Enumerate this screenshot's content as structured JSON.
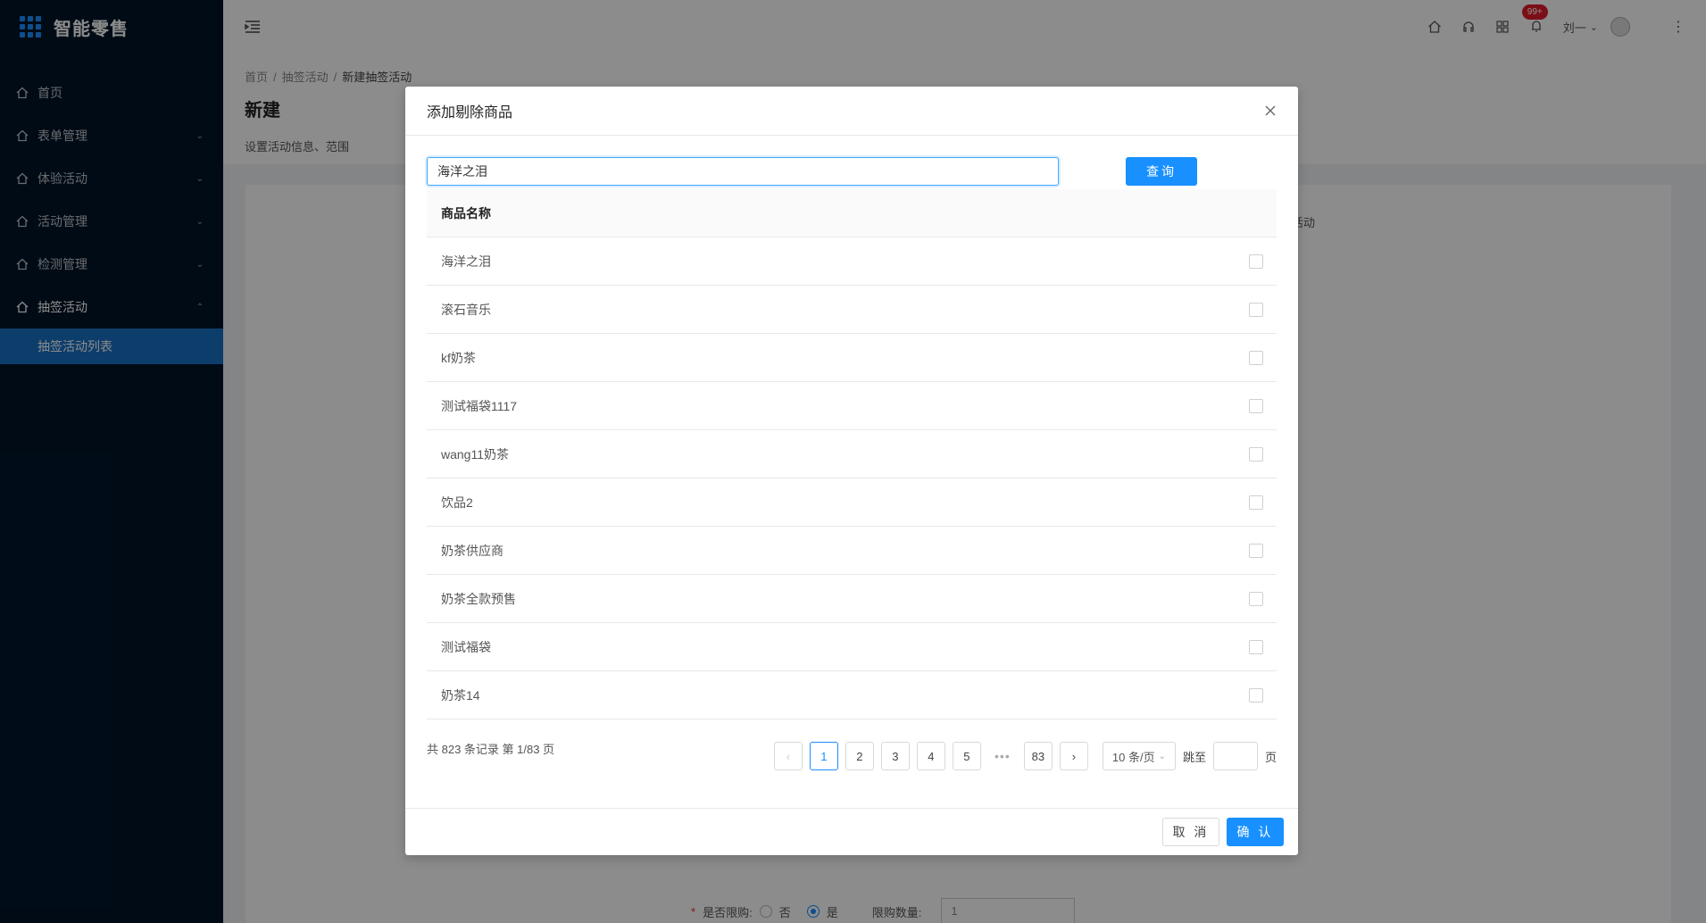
{
  "app": {
    "title": "智能零售"
  },
  "sidebar": {
    "items": [
      {
        "label": "首页",
        "icon": "home-icon"
      },
      {
        "label": "表单管理",
        "icon": "home-icon"
      },
      {
        "label": "体验活动",
        "icon": "home-icon"
      },
      {
        "label": "活动管理",
        "icon": "home-icon"
      },
      {
        "label": "检测管理",
        "icon": "home-icon"
      },
      {
        "label": "抽签活动",
        "icon": "home-icon"
      }
    ],
    "sub_item": "抽签活动列表"
  },
  "header": {
    "notification_count": "99+",
    "user_name": "刘一"
  },
  "page": {
    "breadcrumb": [
      "首页",
      "抽签活动",
      "新建抽签活动"
    ],
    "title": "新建",
    "description": "设置活动信息、范围",
    "bg_fragment": "活动",
    "limit_label": "是否限购:",
    "limit_no": "否",
    "limit_yes": "是",
    "limit_qty_label": "限购数量:",
    "limit_qty_value": "1"
  },
  "modal": {
    "title": "添加剔除商品",
    "search_value": "海洋之泪",
    "search_button": "查询",
    "column_header": "商品名称",
    "rows": [
      "海洋之泪",
      "滚石音乐",
      "kf奶茶",
      "测试福袋1117",
      "wang11奶茶",
      "饮品2",
      "奶茶供应商",
      "奶茶全款预售",
      "测试福袋",
      "奶茶14"
    ],
    "total_text": "共 823 条记录 第 1/83 页",
    "pages": [
      "1",
      "2",
      "3",
      "4",
      "5"
    ],
    "last_page": "83",
    "ellipsis": "•••",
    "page_size": "10 条/页",
    "jump_label": "跳至",
    "jump_suffix": "页",
    "cancel": "取 消",
    "confirm": "确 认"
  }
}
